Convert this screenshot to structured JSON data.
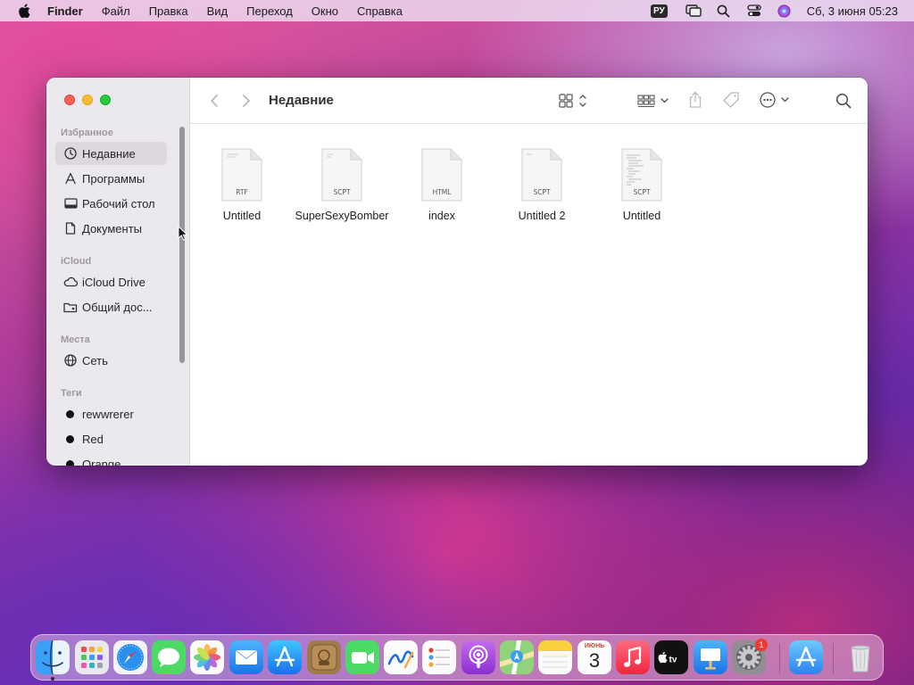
{
  "menubar": {
    "app_name": "Finder",
    "menus": [
      "Файл",
      "Правка",
      "Вид",
      "Переход",
      "Окно",
      "Справка"
    ],
    "input_source": "РУ",
    "clock": "Сб, 3 июня  05:23"
  },
  "window": {
    "title": "Недавние",
    "sidebar": {
      "sections": {
        "favorites": "Избранное",
        "icloud": "iCloud",
        "locations": "Места",
        "tags": "Теги"
      },
      "favorites": [
        {
          "label": "Недавние",
          "icon": "clock-icon",
          "active": true
        },
        {
          "label": "Программы",
          "icon": "applications-icon"
        },
        {
          "label": "Рабочий стол",
          "icon": "desktop-icon"
        },
        {
          "label": "Документы",
          "icon": "document-icon"
        }
      ],
      "icloud": [
        {
          "label": "iCloud Drive",
          "icon": "cloud-icon"
        },
        {
          "label": "Общий дос...",
          "icon": "shared-folder-icon"
        }
      ],
      "locations": [
        {
          "label": "Сеть",
          "icon": "globe-icon"
        }
      ],
      "tags": [
        {
          "label": "rewwrerer",
          "color": "#111111"
        },
        {
          "label": "Red",
          "color": "#111111"
        },
        {
          "label": "Orange",
          "color": "#111111"
        }
      ]
    },
    "files": [
      {
        "name": "Untitled",
        "ext": "RTF"
      },
      {
        "name": "SuperSexyBomber",
        "ext": "SCPT"
      },
      {
        "name": "index",
        "ext": "HTML"
      },
      {
        "name": "Untitled 2",
        "ext": "SCPT"
      },
      {
        "name": "Untitled",
        "ext": "SCPT"
      }
    ]
  },
  "dock": {
    "apps": [
      "Finder",
      "Launchpad",
      "Safari",
      "Messages",
      "Photos",
      "Mail",
      "App Store",
      "Notes Scanner",
      "FaceTime",
      "Freeform",
      "Reminders",
      "Podcasts",
      "Maps",
      "Notes",
      "Calendar",
      "Music",
      "Apple TV",
      "Keynote",
      "System Settings"
    ],
    "calendar_month": "ИЮНЬ",
    "calendar_day": "3",
    "settings_badge": "1",
    "after_separator": [
      "App Store",
      "Trash"
    ]
  }
}
